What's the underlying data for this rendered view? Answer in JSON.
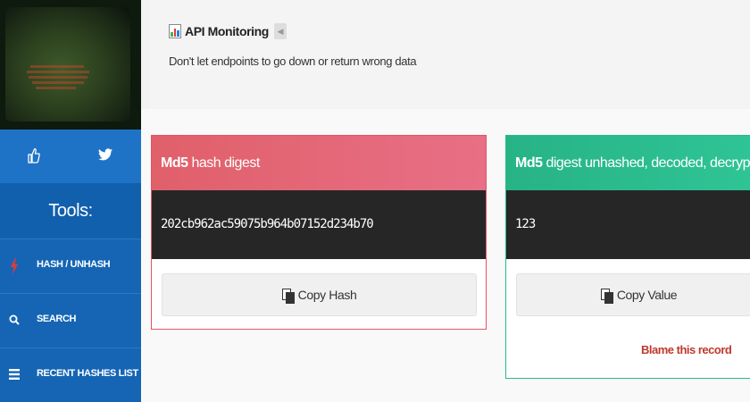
{
  "sidebar": {
    "social": {
      "like_icon": "thumbs-up-icon",
      "twitter_icon": "twitter-icon"
    },
    "tools_title": "Tools:",
    "items": [
      {
        "label": "HASH / UNHASH",
        "icon": "lightning-icon",
        "icon_color": "#e53935"
      },
      {
        "label": "SEARCH",
        "icon": "search-icon",
        "icon_color": "#ffffff"
      },
      {
        "label": "RECENT HASHES LIST",
        "icon": "list-icon",
        "icon_color": "#ffffff"
      }
    ]
  },
  "banner": {
    "title": "API Monitoring",
    "subtitle": "Don't let endpoints to go down or return wrong data"
  },
  "hash_card": {
    "title_bold": "Md5",
    "title_rest": " hash digest",
    "value": "202cb962ac59075b964b07152d234b70",
    "copy_label": "Copy Hash",
    "color": "#e0606a"
  },
  "unhash_card": {
    "title_bold": "Md5",
    "title_rest": " digest unhashed, decoded, decrypted, reversed",
    "value": "123",
    "copy_label": "Copy Value",
    "blame_label": "Blame this record",
    "color": "#27b386"
  }
}
